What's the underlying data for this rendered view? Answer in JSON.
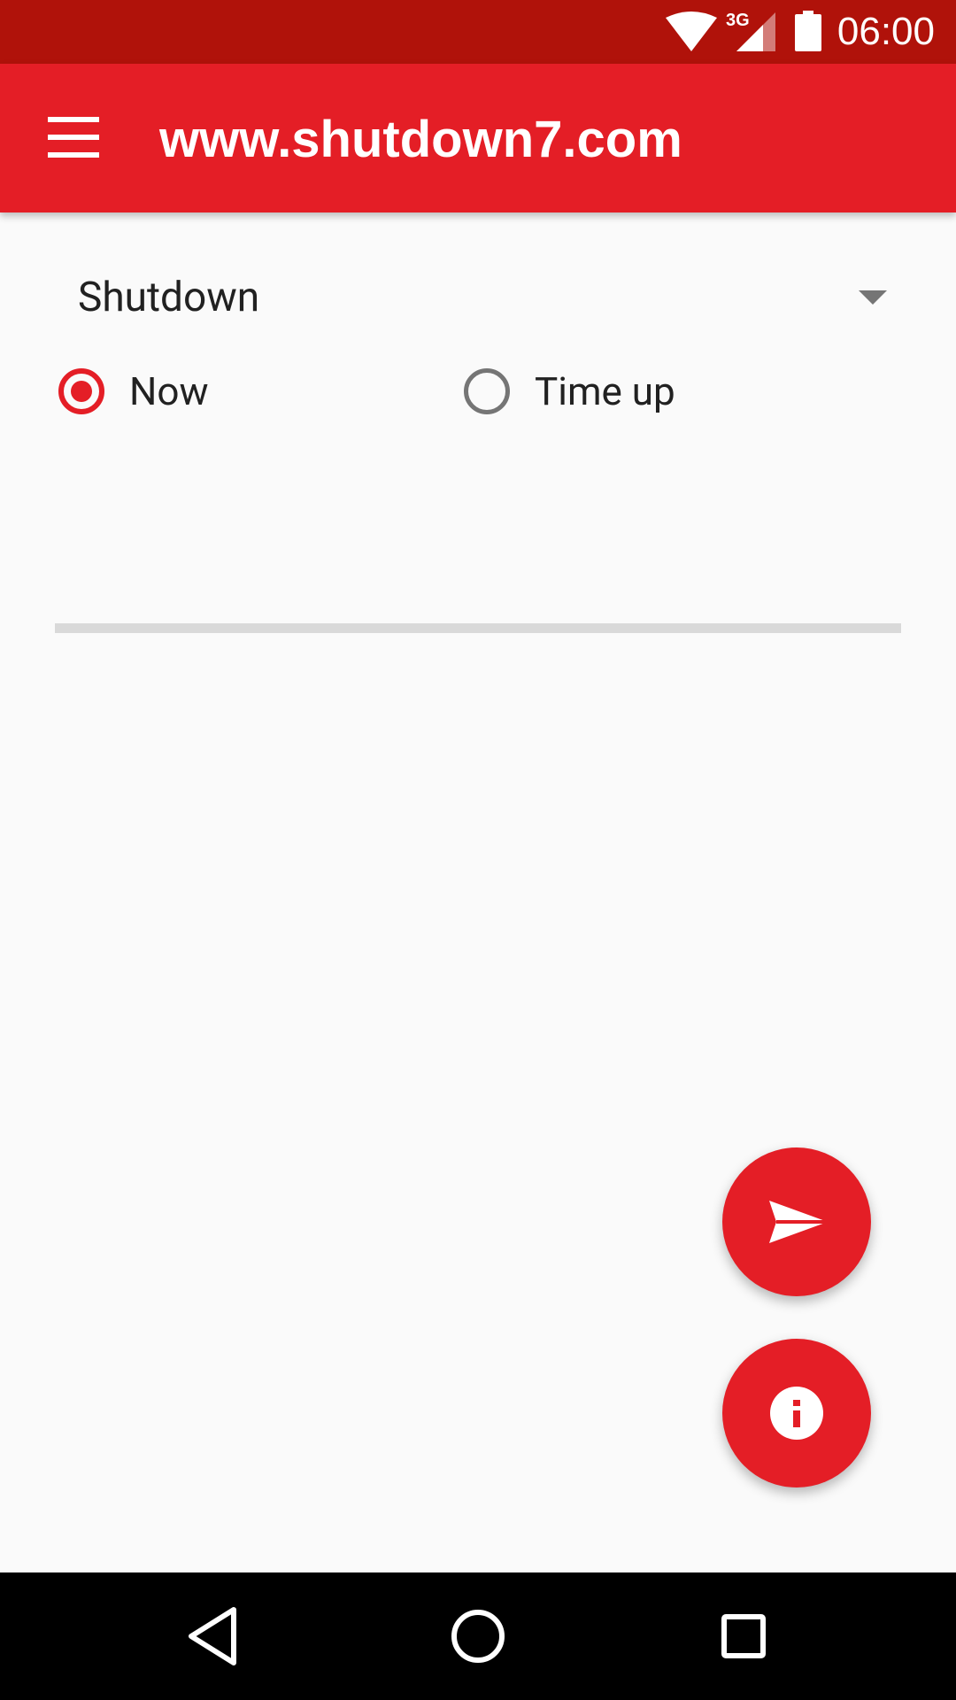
{
  "status_bar": {
    "time": "06:00",
    "network_type": "3G",
    "icons": [
      "wifi-icon",
      "cell-signal-icon",
      "battery-icon"
    ]
  },
  "app_bar": {
    "title": "www.shutdown7.com",
    "menu_icon": "menu-icon"
  },
  "form": {
    "action_spinner": {
      "selected": "Shutdown"
    },
    "timing": {
      "options": [
        {
          "label": "Now",
          "checked": true
        },
        {
          "label": "Time up",
          "checked": false
        }
      ]
    },
    "progress": 0
  },
  "fabs": {
    "send_icon": "send-icon",
    "info_icon": "info-icon"
  },
  "nav_bar": {
    "icons": [
      "back-icon",
      "home-icon",
      "recents-icon"
    ]
  },
  "colors": {
    "status_bar": "#b0120a",
    "primary": "#e41e26",
    "background": "#fafafa",
    "nav_bar": "#000000"
  }
}
